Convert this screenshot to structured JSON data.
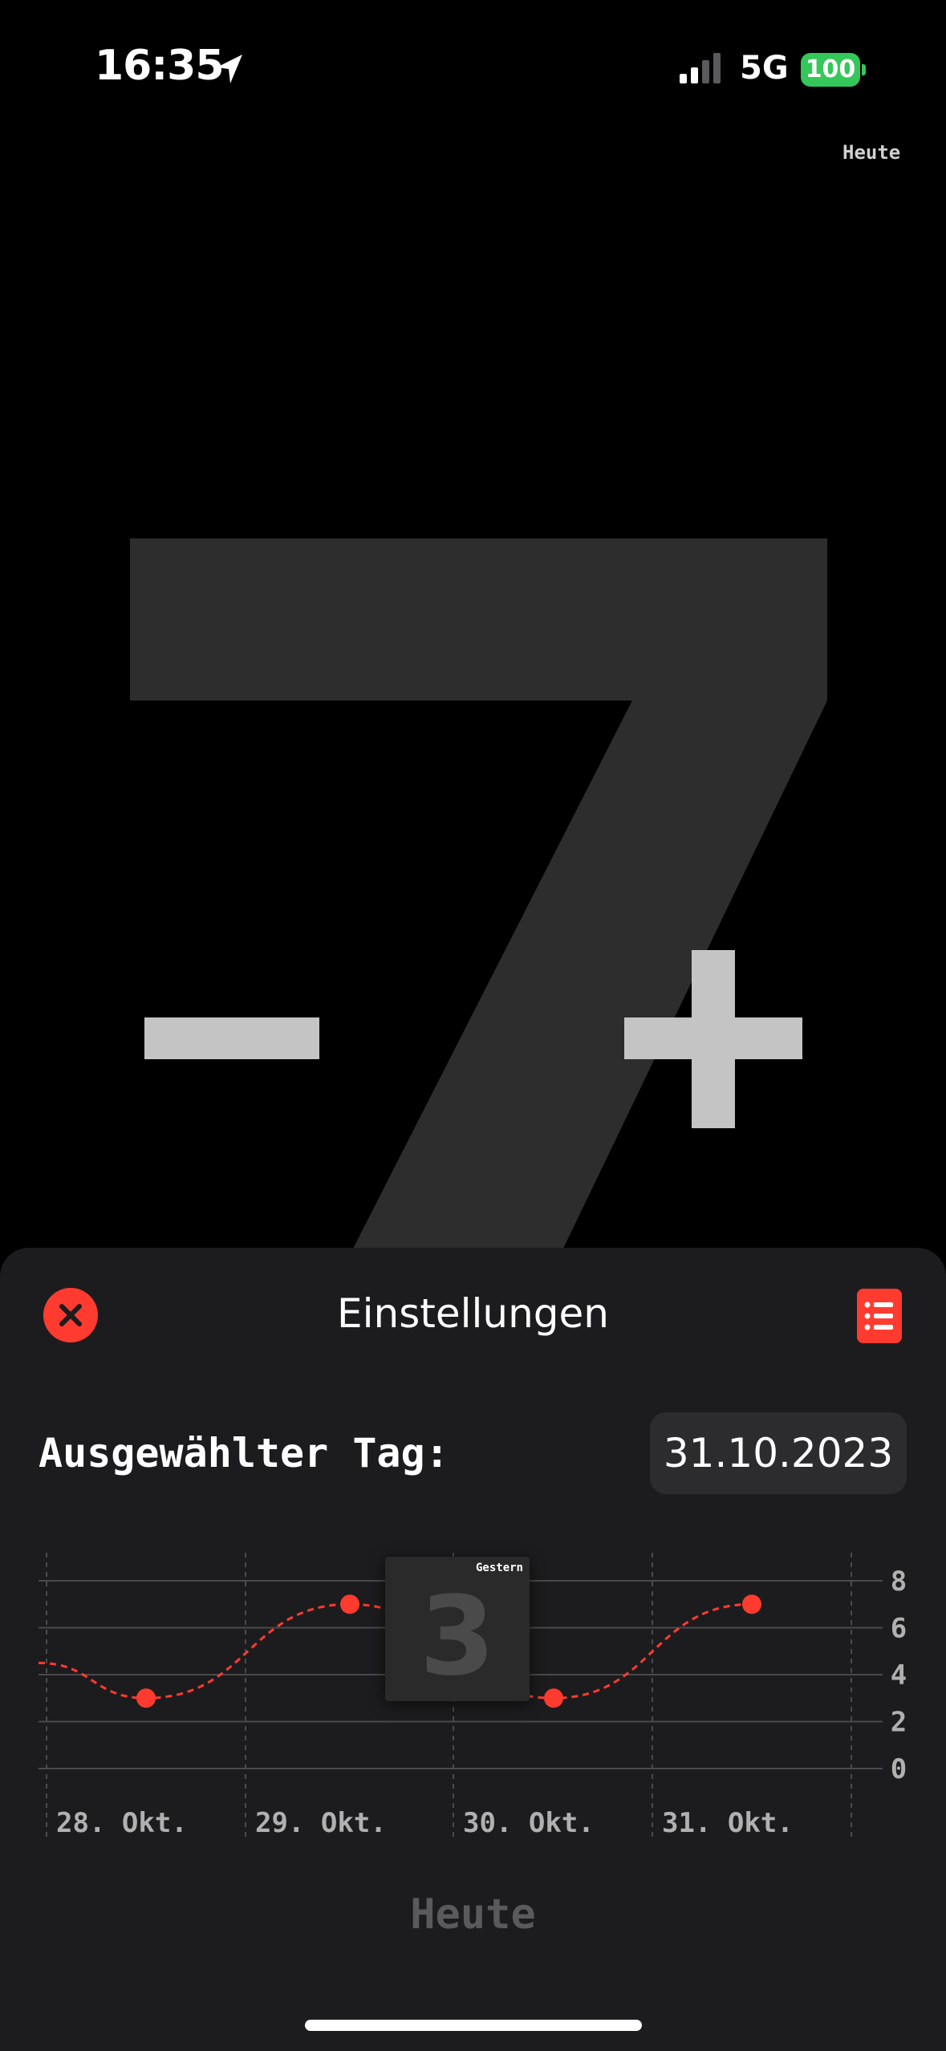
{
  "status_bar": {
    "time": "16:35",
    "network": "5G",
    "battery": "100"
  },
  "header": {
    "today_link": "Heute"
  },
  "counter": {
    "value": "7"
  },
  "sheet": {
    "title": "Einstellungen",
    "selected_day_label": "Ausgewählter Tag:",
    "selected_date": "31.10.2023",
    "today_button": "Heute"
  },
  "chart_data": {
    "type": "line",
    "categories": [
      "28. Okt.",
      "29. Okt.",
      "30. Okt.",
      "31. Okt."
    ],
    "series": [
      {
        "values": [
          3,
          7,
          3,
          7
        ]
      }
    ],
    "yticks": [
      "8",
      "6",
      "4",
      "2",
      "0"
    ],
    "ylim": [
      0,
      8
    ],
    "grid": true,
    "color": "#ff3b30",
    "selected_point": {
      "label": "Gestern",
      "value": "3"
    }
  },
  "colors": {
    "accent": "#ff3b30",
    "sheet_bg": "#1c1c1e",
    "battery": "#34c759"
  },
  "icons": {
    "close": "xmark-circle-icon",
    "list": "list-bullet-icon",
    "location": "location-arrow-icon"
  }
}
